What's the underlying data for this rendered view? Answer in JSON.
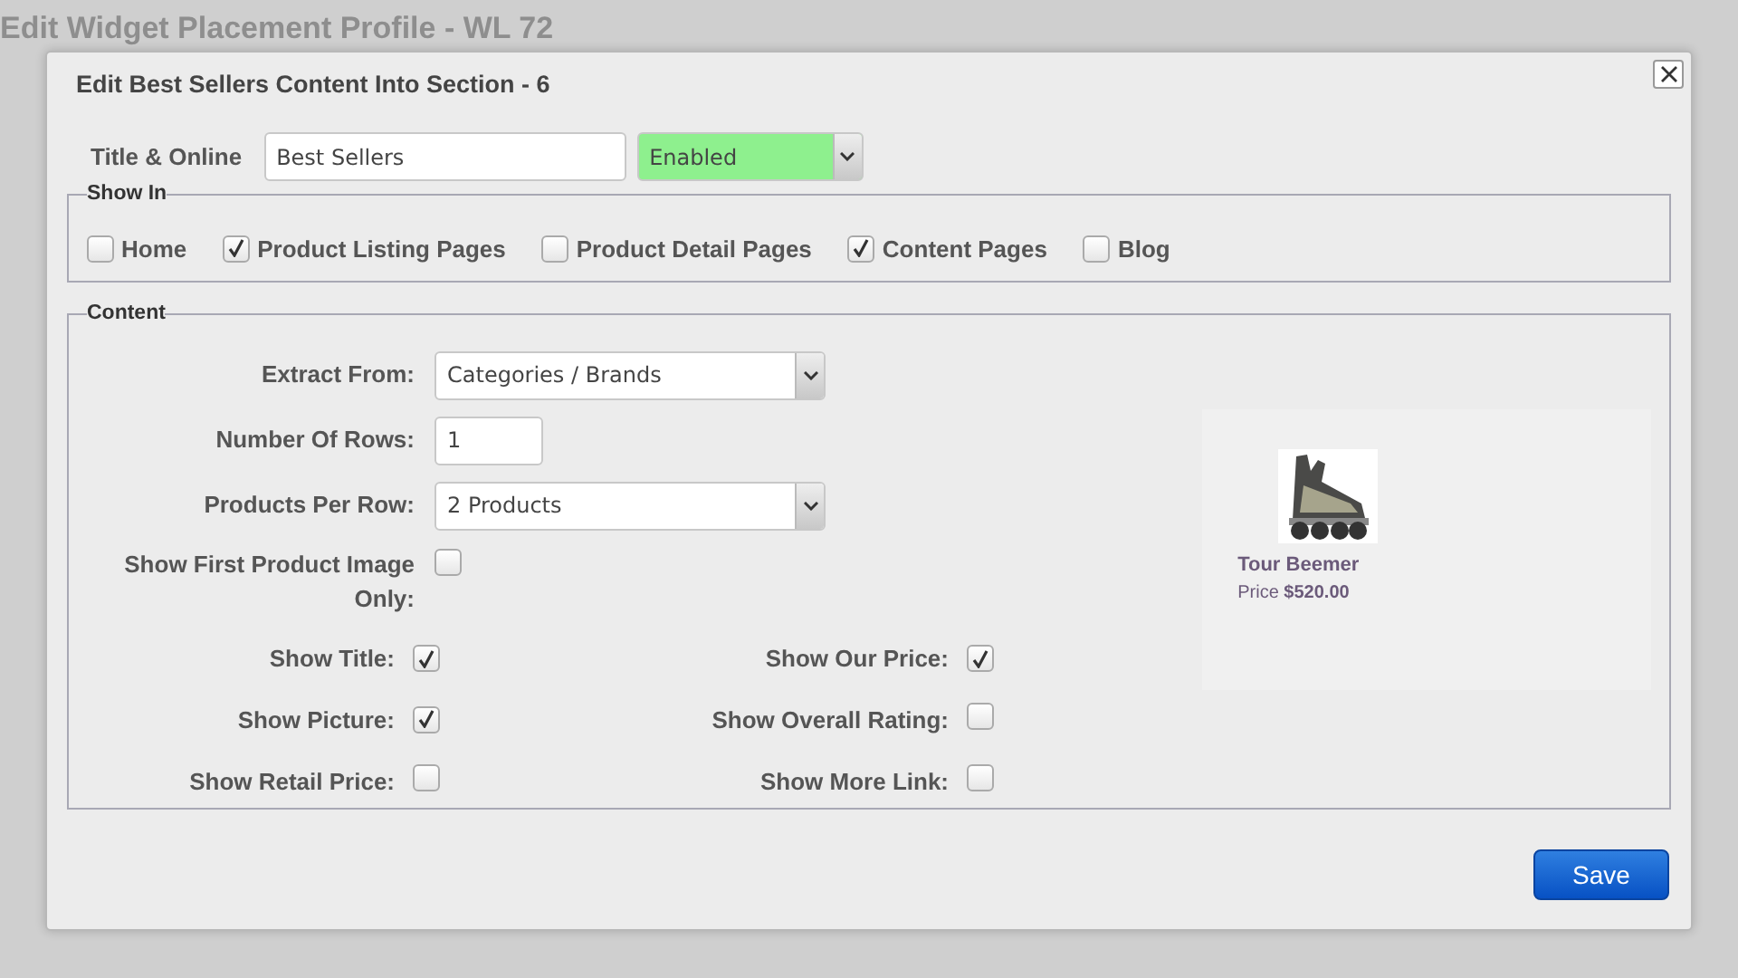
{
  "page": {
    "title": "Edit Widget Placement Profile - WL 72"
  },
  "dialog": {
    "title": "Edit Best Sellers Content Into Section - 6"
  },
  "title_online": {
    "label": "Title & Online",
    "title_value": "Best Sellers",
    "status": "Enabled"
  },
  "show_in": {
    "legend": "Show In",
    "options": [
      {
        "label": "Home",
        "checked": false
      },
      {
        "label": "Product Listing Pages",
        "checked": true
      },
      {
        "label": "Product Detail Pages",
        "checked": false
      },
      {
        "label": "Content Pages",
        "checked": true
      },
      {
        "label": "Blog",
        "checked": false
      }
    ]
  },
  "content": {
    "legend": "Content",
    "fields": [
      {
        "kind": "select",
        "label": "Extract From:",
        "value": "Categories / Brands"
      },
      {
        "kind": "text",
        "label": "Number Of Rows:",
        "value": "1"
      },
      {
        "kind": "select",
        "label": "Products Per Row:",
        "value": "2 Products"
      },
      {
        "kind": "checkbox",
        "label": "Show First Product Image Only:",
        "checked": false
      }
    ],
    "options": [
      {
        "label": "Show Title:",
        "checked": true
      },
      {
        "label": "Show Our Price:",
        "checked": true
      },
      {
        "label": "Show Picture:",
        "checked": true
      },
      {
        "label": "Show Overall Rating:",
        "checked": false
      },
      {
        "label": "Show Retail Price:",
        "checked": false
      },
      {
        "label": "Show More Link:",
        "checked": false
      }
    ]
  },
  "preview": {
    "title": "Tour Beemer",
    "price_label": "Price",
    "price": "$520.00"
  },
  "buttons": {
    "save": "Save"
  }
}
